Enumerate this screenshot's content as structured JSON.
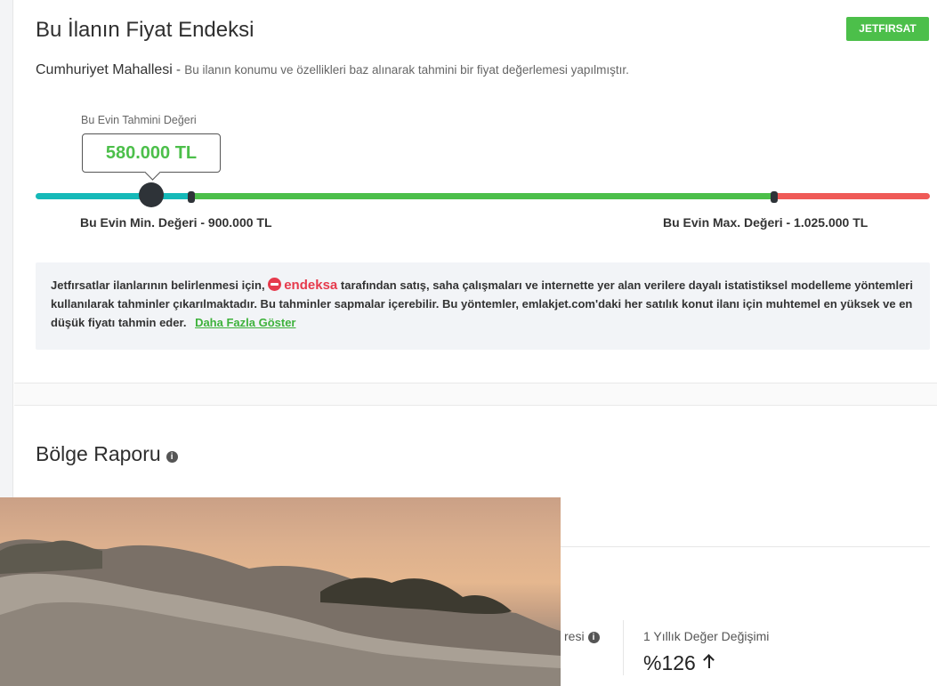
{
  "price_index": {
    "title": "Bu İlanın Fiyat Endeksi",
    "badge": "JETFIRSAT",
    "location": "Cumhuriyet Mahallesi",
    "separator": " - ",
    "description": "Bu ilanın konumu ve özellikleri baz alınarak tahmini bir fiyat değerlemesi yapılmıştır.",
    "estimate_label": "Bu Evin Tahmini Değeri",
    "estimate_value": "580.000 TL",
    "min_label": "Bu Evin Min. Değeri - 900.000 TL",
    "max_label": "Bu Evin Max. Değeri - 1.025.000 TL",
    "info_text_before": "Jetfırsatlar ilanlarının belirlenmesi için,",
    "brand_name": "endeksa",
    "info_text_after": "tarafından satış, saha çalışmaları ve internette yer alan verilere dayalı istatistiksel modelleme yöntemleri kullanılarak tahminler çıkarılmaktadır. Bu tahminler sapmalar içerebilir. Bu yöntemler, emlakjet.com'daki her satılık konut ilanı için muhtemel en yüksek ve en düşük fiyatı tahmin eder.",
    "more_link": "Daha Fazla Göster",
    "colors": {
      "low": "#15b9b8",
      "mid": "#4cbf4a",
      "high": "#ef5a57"
    }
  },
  "region_report": {
    "title": "Bölge Raporu",
    "partial_stat_label": "resi",
    "stat_label": "1 Yıllık Değer Değişimi",
    "stat_value": "%126"
  }
}
